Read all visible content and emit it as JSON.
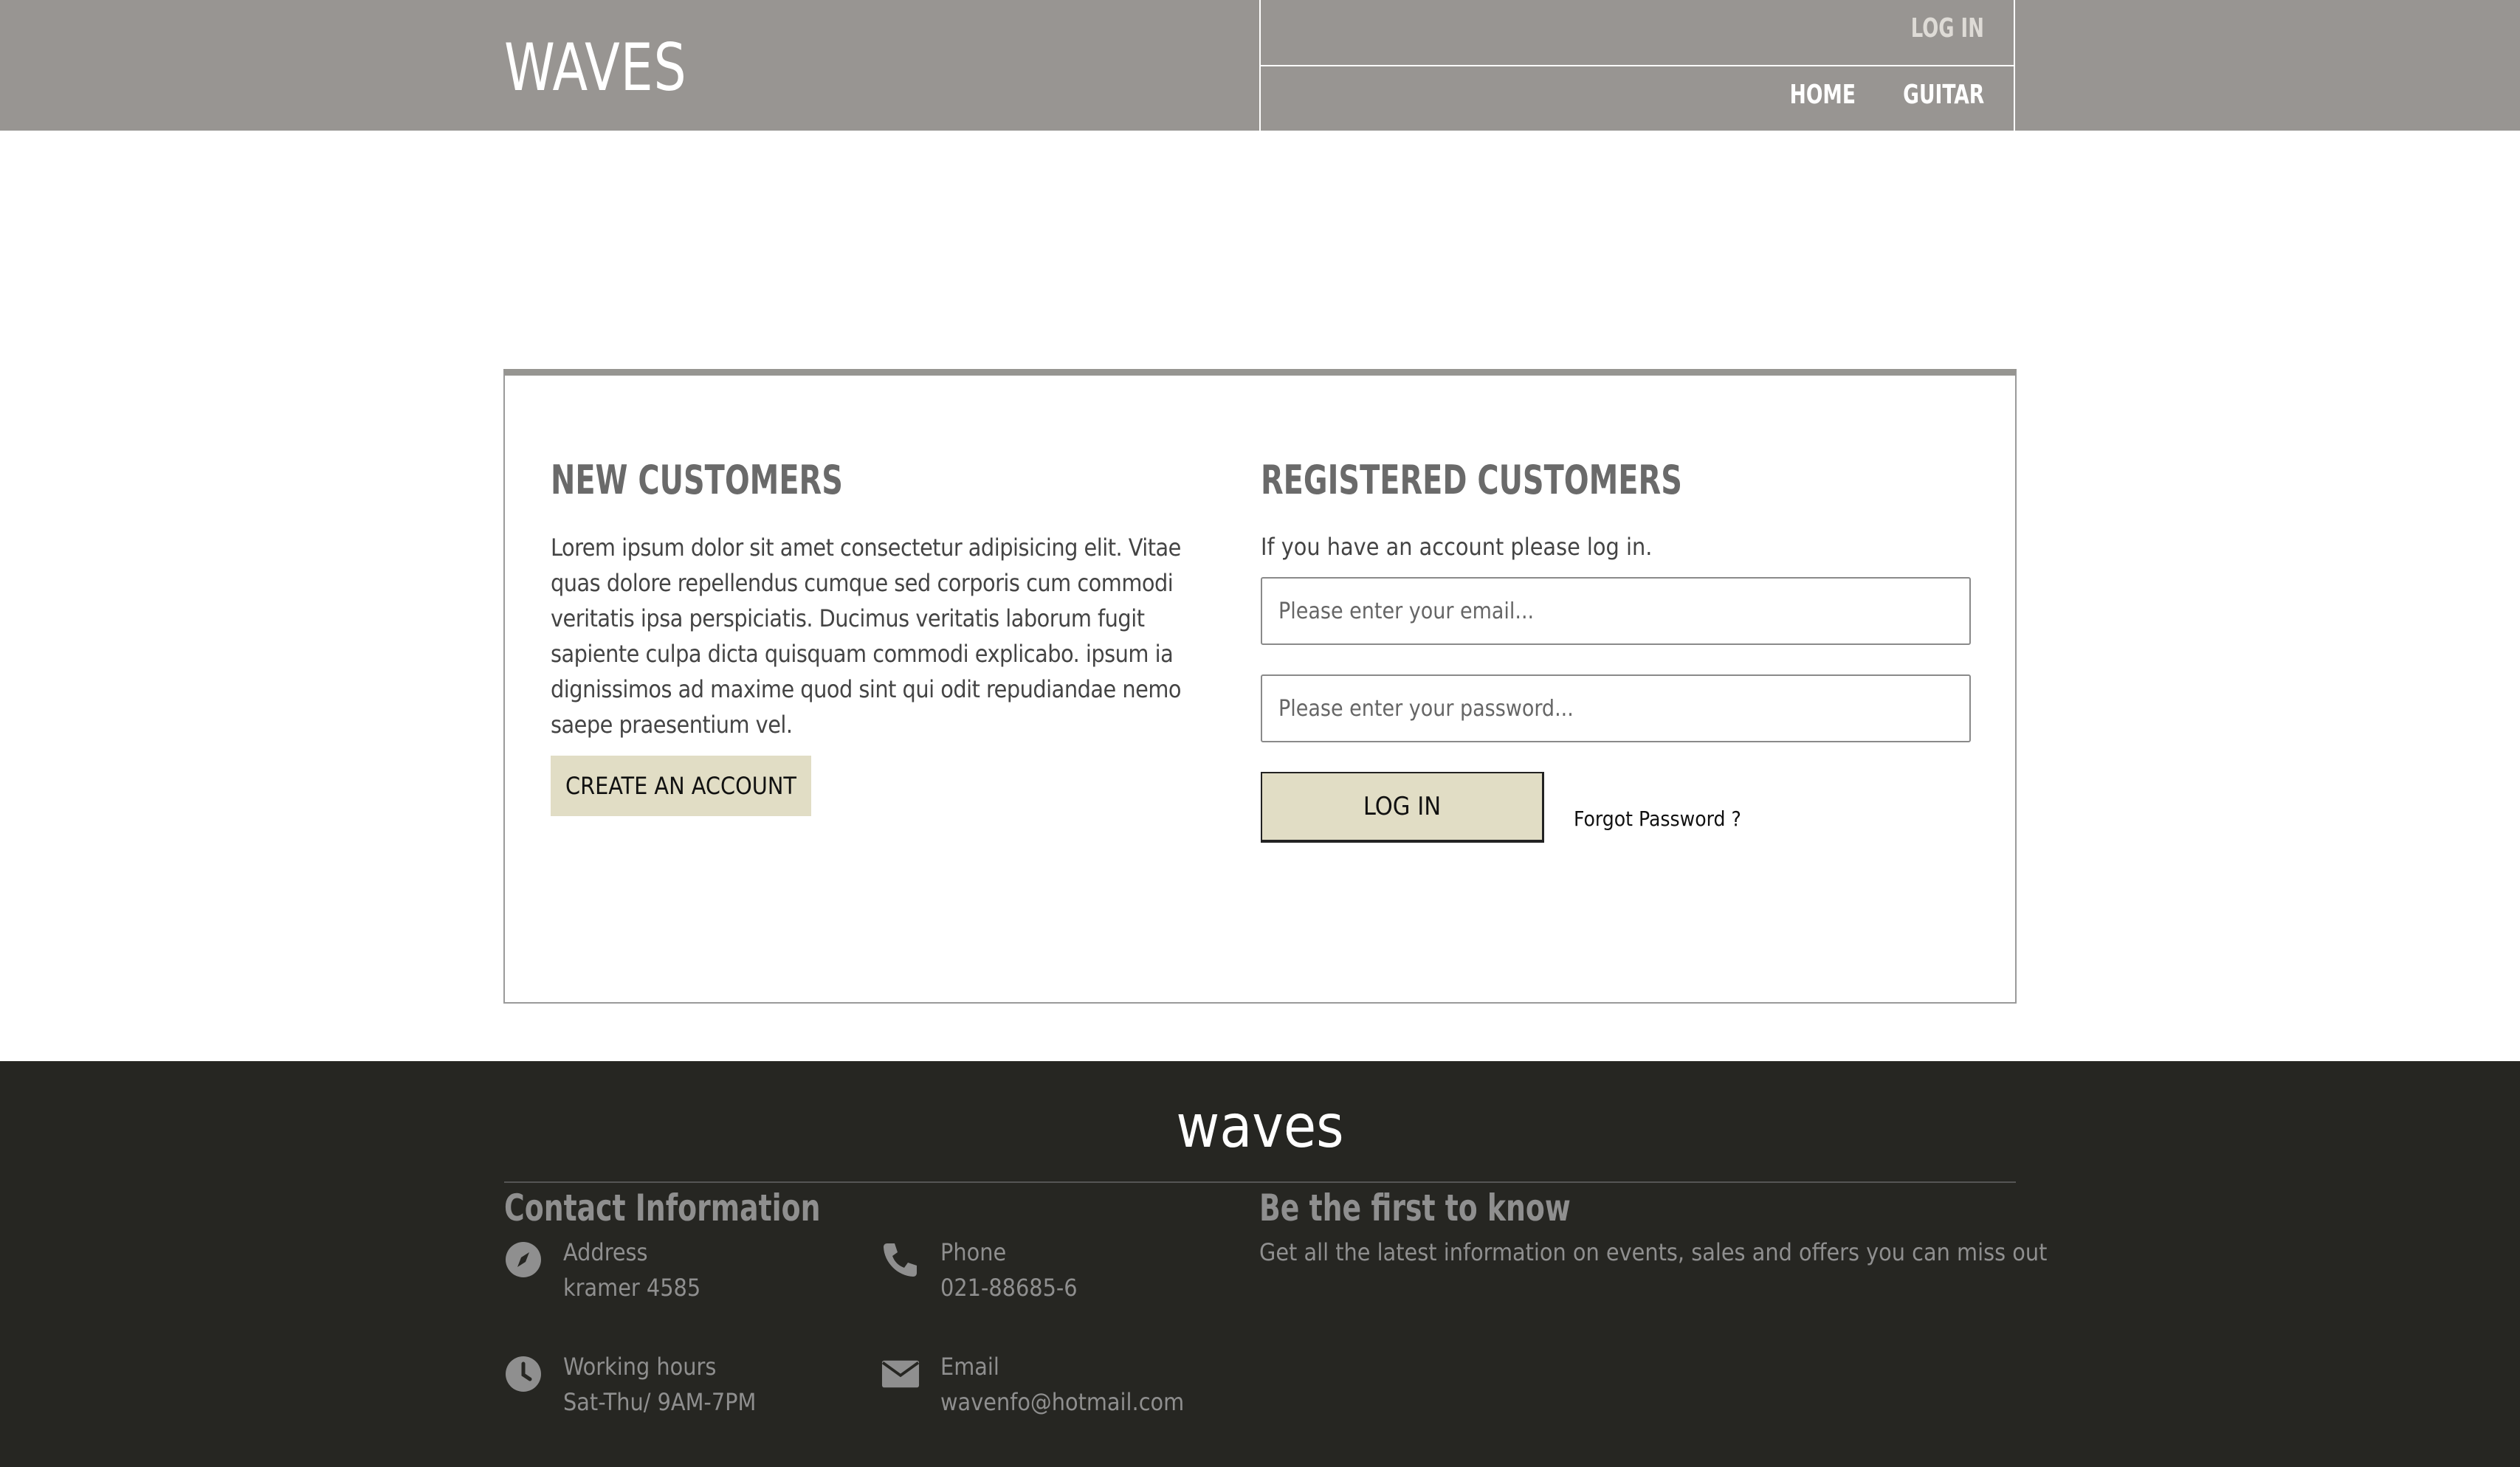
{
  "header": {
    "logo": "WAVES",
    "login_link": "LOG IN",
    "nav": [
      {
        "label": "HOME"
      },
      {
        "label": "GUITAR"
      }
    ]
  },
  "new_customers": {
    "title": "NEW CUSTOMERS",
    "text": "Lorem ipsum dolor sit amet consectetur adipisicing elit. Vitae quas dolore repellendus cumque sed corporis cum commodi veritatis ipsa perspiciatis. Ducimus veritatis laborum fugit sapiente culpa dicta quisquam commodi explicabo. ipsum ia dignissimos ad maxime quod sint qui odit repudiandae nemo saepe praesentium vel.",
    "button": "CREATE AN ACCOUNT"
  },
  "registered_customers": {
    "title": "REGISTERED CUSTOMERS",
    "intro": "If you have an account please log in.",
    "email_placeholder": "Please enter your email...",
    "password_placeholder": "Please enter your password...",
    "login_button": "LOG IN",
    "forgot_link": "Forgot Password ?"
  },
  "footer": {
    "logo": "waves",
    "contact_heading": "Contact Information",
    "contacts": [
      {
        "icon": "compass-icon",
        "label": "Address",
        "value": "kramer 4585"
      },
      {
        "icon": "phone-icon",
        "label": "Phone",
        "value": "021-88685-6"
      },
      {
        "icon": "clock-icon",
        "label": "Working hours",
        "value": "Sat-Thu/ 9AM-7PM"
      },
      {
        "icon": "envelope-icon",
        "label": "Email",
        "value": "wavenfo@hotmail.com"
      }
    ],
    "newsletter_heading": "Be the first to know",
    "newsletter_text": "Get all the latest information on events, sales and offers you can miss out"
  },
  "colors": {
    "header_bg": "#989592",
    "accent_button": "#e1ddc5",
    "footer_bg": "#262622"
  }
}
